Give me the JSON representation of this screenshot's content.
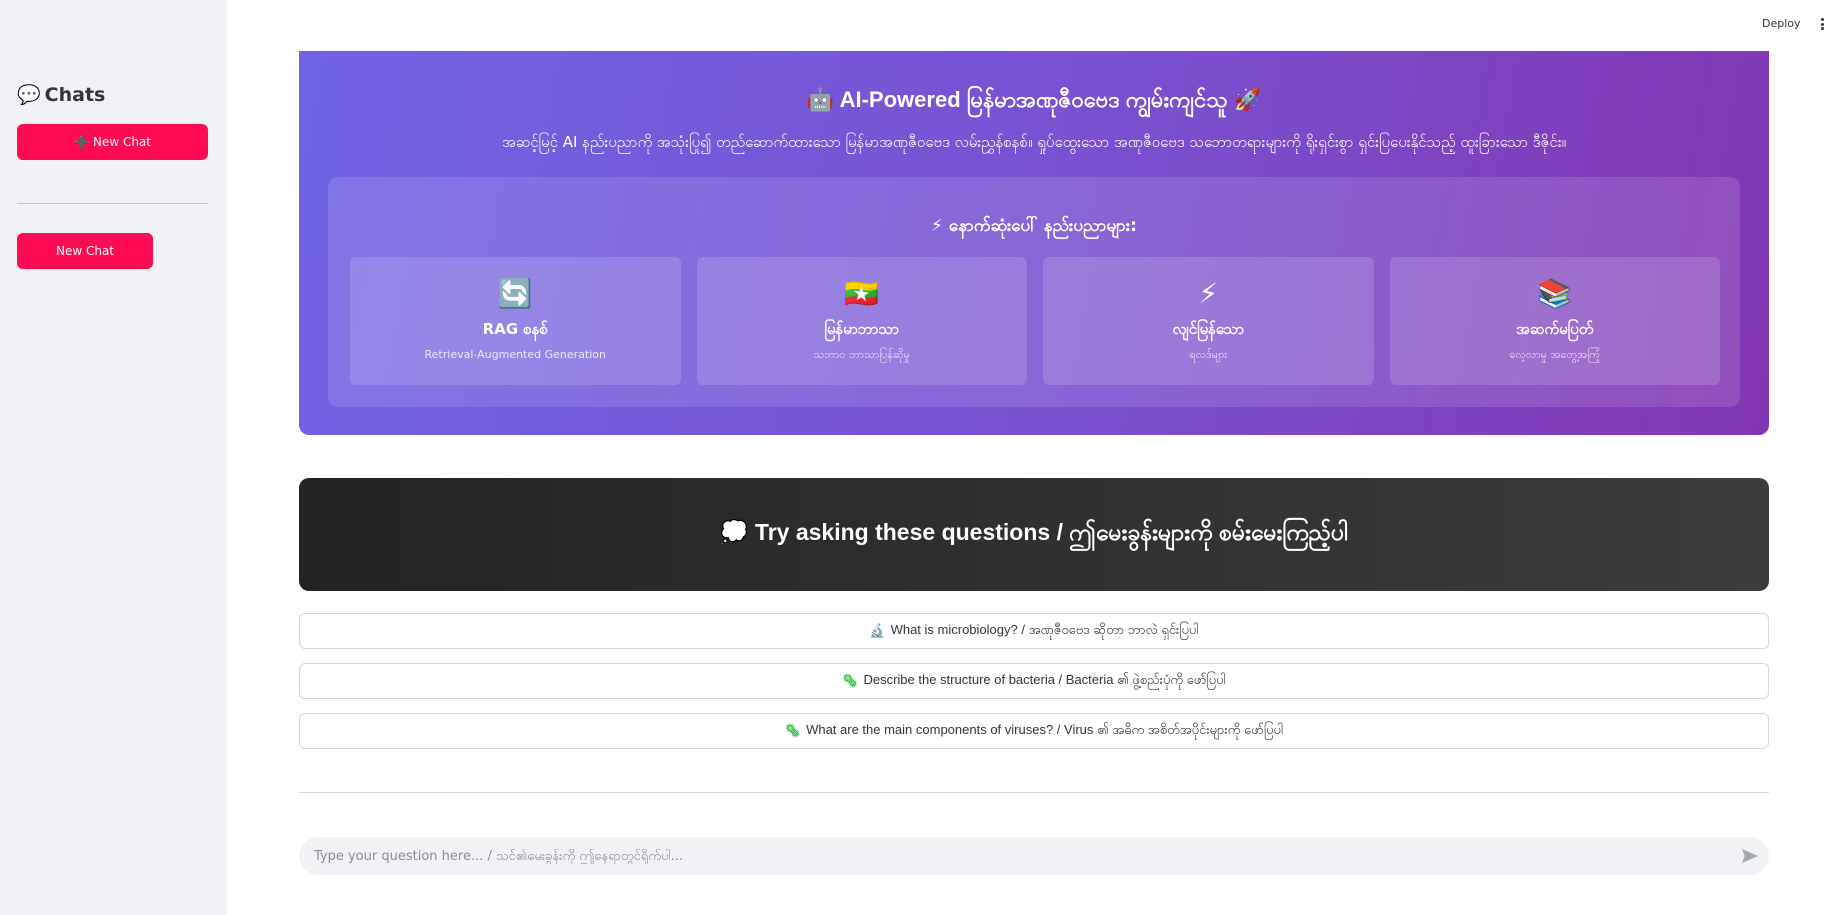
{
  "sidebar": {
    "title_icon": "💬",
    "title": "Chats",
    "new_chat_icon": "➕",
    "new_chat_label": "New Chat",
    "history": [
      {
        "label": "New Chat"
      }
    ]
  },
  "header": {
    "deploy_label": "Deploy",
    "menu_icon": "kebab-menu-icon"
  },
  "hero": {
    "title": "🤖 AI-Powered မြန်မာအဏုဇီဝဗေဒ ကျွမ်းကျင်သူ 🚀",
    "subtitle": "အဆင့်မြင့် AI နည်းပညာကို အသုံးပြု၍ တည်ဆောက်ထားသော မြန်မာအဏုဇီဝဗေဒ လမ်းညွှန်စနစ်။ ရှုပ်ထွေးသော အဏုဇီဝဗေဒ သဘောတရားများကို ရိုးရှင်းစွာ ရှင်းပြပေးနိုင်သည့် ထူးခြားသော ဒီဇိုင်း။",
    "features_title": "⚡ နောက်ဆုံးပေါ် နည်းပညာများ:",
    "features": [
      {
        "icon": "🔄",
        "title": "RAG စနစ်",
        "subtitle": "Retrieval-Augmented Generation"
      },
      {
        "icon": "🇲🇲",
        "title": "မြန်မာဘာသာ",
        "subtitle": "သဘာဝ ဘာသာပြန်ဆိုမှု"
      },
      {
        "icon": "⚡",
        "title": "လျင်မြန်သော",
        "subtitle": "ရလဒ်များ"
      },
      {
        "icon": "📚",
        "title": "အဆက်မပြတ်",
        "subtitle": "လေ့လာမှု အတွေ့အကြုံ"
      }
    ]
  },
  "banner": {
    "text": "💭 Try asking these questions / ဤမေးခွန်းများကို စမ်းမေးကြည့်ပါ"
  },
  "questions": [
    {
      "icon": "🔬",
      "text": "What is microbiology? / အဏုဇီဝဗေဒ ဆိုတာ ဘာလဲ ရှင်းပြပါ"
    },
    {
      "icon": "🦠",
      "text": "Describe the structure of bacteria / Bacteria ၏ ဖွဲ့စည်းပုံကို ဖော်ပြပါ"
    },
    {
      "icon": "🦠",
      "text": "What are the main components of viruses? / Virus ၏ အဓိက အစိတ်အပိုင်းများကို ဖော်ပြပါ"
    }
  ],
  "chat_input": {
    "placeholder": "Type your question here... / သင်၏မေးခွန်းကို ဤနေရာတွင်ရိုက်ပါ..."
  },
  "colors": {
    "accent": "#ff0b53",
    "hero_start": "#6f64e4",
    "hero_end": "#8336b2",
    "banner": "#2b2c2e",
    "sidebar_bg": "#f0f2f6"
  }
}
